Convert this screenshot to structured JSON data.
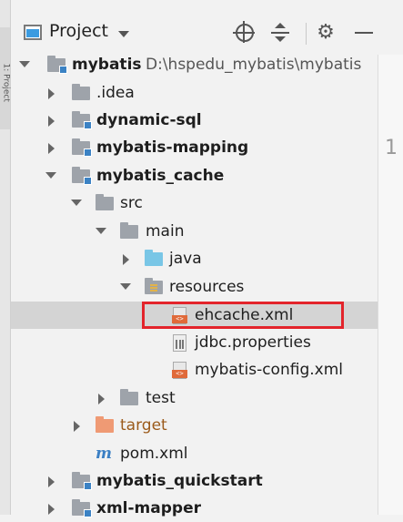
{
  "panel": {
    "title": "Project",
    "strip_label": "1: Project"
  },
  "editor": {
    "line_number": "1"
  },
  "tree": {
    "root": {
      "name": "mybatis",
      "path": "D:\\hspedu_mybatis\\mybatis"
    },
    "items": [
      {
        "label": ".idea"
      },
      {
        "label": "dynamic-sql"
      },
      {
        "label": "mybatis-mapping"
      },
      {
        "label": "mybatis_cache"
      },
      {
        "label": "src"
      },
      {
        "label": "main"
      },
      {
        "label": "java"
      },
      {
        "label": "resources"
      },
      {
        "label": "ehcache.xml"
      },
      {
        "label": "jdbc.properties"
      },
      {
        "label": "mybatis-config.xml"
      },
      {
        "label": "test"
      },
      {
        "label": "target"
      },
      {
        "label": "pom.xml"
      },
      {
        "label": "mybatis_quickstart"
      },
      {
        "label": "xml-mapper"
      }
    ]
  },
  "colors": {
    "highlight": "#e3242b",
    "selected_row": "#d4d4d4"
  }
}
